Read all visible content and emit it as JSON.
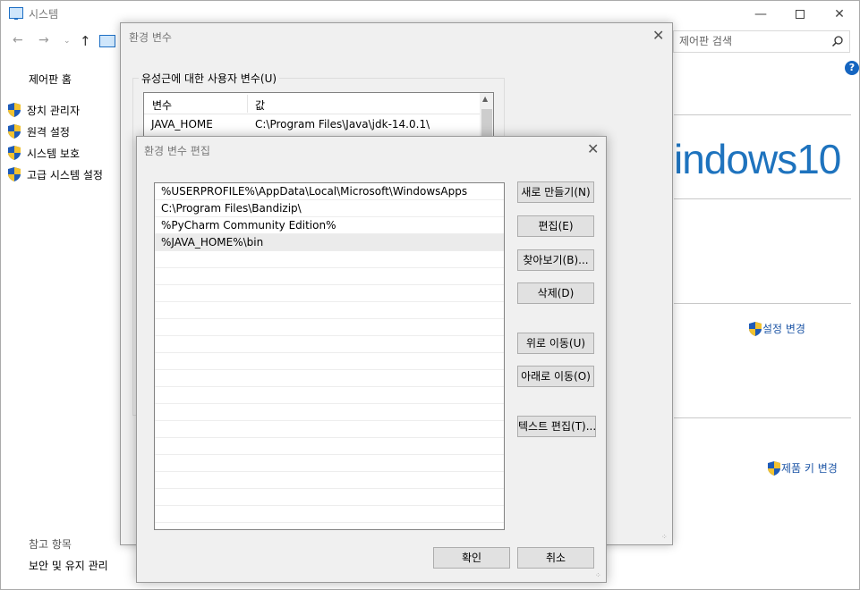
{
  "system_window": {
    "title": "시스템",
    "search_placeholder": "제어판 검색",
    "help_label": "?",
    "left_pane": {
      "home": "제어판 홈",
      "links": [
        "장치 관리자",
        "원격 설정",
        "시스템 보호",
        "고급 시스템 설정"
      ],
      "see_also": "참고 항목",
      "see_also_link": "보안 및 유지 관리"
    },
    "windows_logo": "indows10",
    "change_settings": "설정 변경",
    "change_product_key": "제품 키 변경"
  },
  "env_dialog": {
    "title": "환경 변수",
    "user_group_label": "유성근에 대한 사용자 변수(U)",
    "columns": [
      "변수",
      "값"
    ],
    "rows": [
      {
        "name": "JAVA_HOME",
        "value": "C:\\Program Files\\Java\\jdk-14.0.1\\"
      }
    ]
  },
  "edit_dialog": {
    "title": "환경 변수 편집",
    "paths": [
      "%USERPROFILE%\\AppData\\Local\\Microsoft\\WindowsApps",
      "C:\\Program Files\\Bandizip\\",
      "%PyCharm Community Edition%",
      "%JAVA_HOME%\\bin"
    ],
    "selected_index": 3,
    "buttons": {
      "new": "새로 만들기(N)",
      "edit": "편집(E)",
      "browse": "찾아보기(B)...",
      "delete": "삭제(D)",
      "move_up": "위로 이동(U)",
      "move_down": "아래로 이동(O)",
      "edit_text": "텍스트 편집(T)...",
      "ok": "확인",
      "cancel": "취소"
    }
  },
  "colors": {
    "accent": "#1e73be",
    "link": "#1e56a6",
    "dialog_bg": "#f0f0f0",
    "selected_row": "#ebebeb"
  }
}
